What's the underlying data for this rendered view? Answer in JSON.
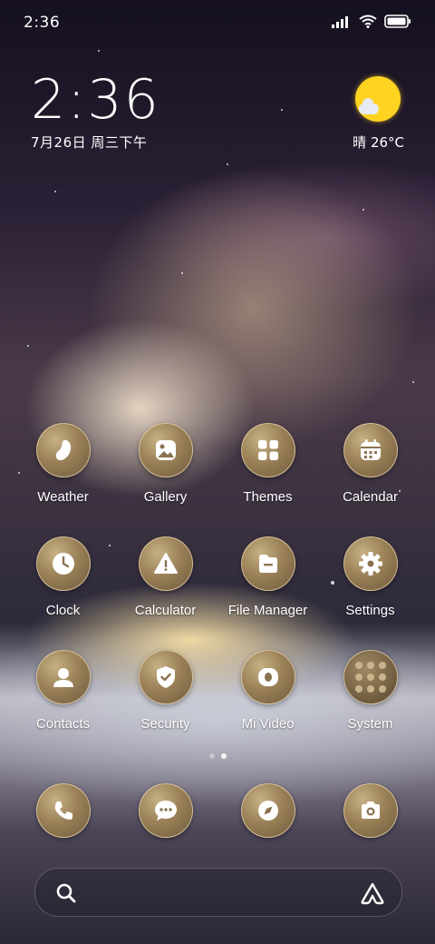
{
  "status_bar": {
    "time": "2:36"
  },
  "clock_widget": {
    "time": "2:36",
    "date": "7月26日 周三下午"
  },
  "weather_widget": {
    "condition": "晴",
    "temperature": "26°C",
    "sun_color": "#ffd320"
  },
  "apps": [
    {
      "label": "Weather",
      "icon": "weather-icon"
    },
    {
      "label": "Gallery",
      "icon": "gallery-icon"
    },
    {
      "label": "Themes",
      "icon": "themes-icon"
    },
    {
      "label": "Calendar",
      "icon": "calendar-icon"
    },
    {
      "label": "Clock",
      "icon": "clock-icon"
    },
    {
      "label": "Calculator",
      "icon": "calculator-icon"
    },
    {
      "label": "File Manager",
      "icon": "file-manager-icon"
    },
    {
      "label": "Settings",
      "icon": "settings-icon"
    },
    {
      "label": "Contacts",
      "icon": "contacts-icon"
    },
    {
      "label": "Security",
      "icon": "security-icon"
    },
    {
      "label": "Mi Video",
      "icon": "mi-video-icon"
    },
    {
      "label": "System",
      "icon": "folder-icon"
    }
  ],
  "page_indicator": {
    "count": 2,
    "active": 1
  },
  "dock": [
    {
      "icon": "phone-icon"
    },
    {
      "icon": "messages-icon"
    },
    {
      "icon": "browser-icon"
    },
    {
      "icon": "camera-icon"
    }
  ],
  "search_bar": {
    "left_icon": "search-icon",
    "right_icon": "assistant-icon"
  },
  "theme": {
    "icon_gold": "#9a8158",
    "text": "#ffffff"
  }
}
